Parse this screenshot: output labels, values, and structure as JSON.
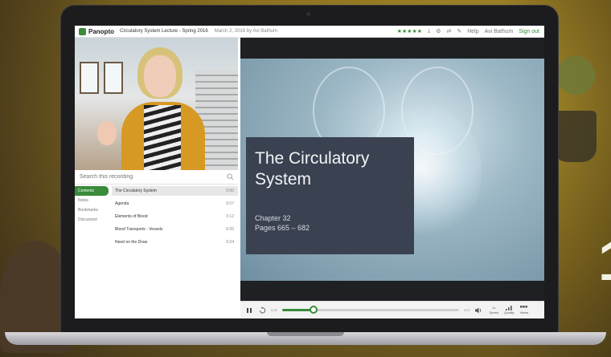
{
  "app": {
    "brand": "Panopto",
    "title": "Circulatory System Lecture - Spring 2016",
    "date": "March 2, 2016 by Avi Bathum",
    "rating_stars": "★★★★★",
    "user_name": "Avi Bathum",
    "help_label": "Help",
    "signout_label": "Sign out",
    "accent_color": "#3a8b3a"
  },
  "search": {
    "placeholder": "Search this recording"
  },
  "tabs": [
    {
      "label": "Contents",
      "active": true
    },
    {
      "label": "Notes"
    },
    {
      "label": "Bookmarks"
    },
    {
      "label": "Discussion"
    }
  ],
  "toc": [
    {
      "title": "The Circulatory System",
      "time": "0:00"
    },
    {
      "title": "Agenda",
      "time": "0:07"
    },
    {
      "title": "Elements of Blood",
      "time": "0:12"
    },
    {
      "title": "Blood Transports - Vessels",
      "time": "0:20"
    },
    {
      "title": "Need on the Draw",
      "time": "0:24"
    }
  ],
  "slide": {
    "title": "The Circulatory System",
    "chapter": "Chapter 32",
    "pages": "Pages 665 – 682"
  },
  "player": {
    "time_current": "0:00",
    "time_total": "0:22",
    "speed_label": "1x",
    "speed_caption": "Speed",
    "quality_caption": "Quality",
    "views_caption": "Views",
    "progress_fraction": 0.18
  }
}
